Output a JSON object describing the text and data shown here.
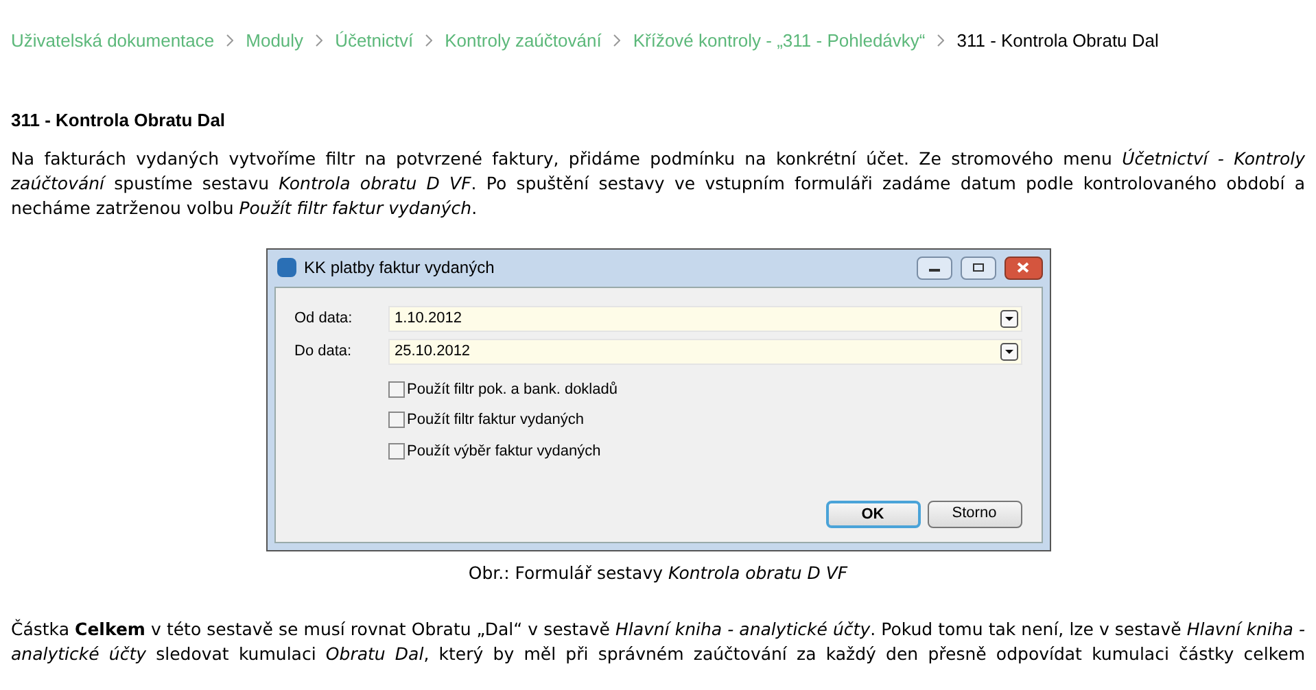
{
  "breadcrumb": [
    {
      "label": "Uživatelská dokumentace",
      "current": false
    },
    {
      "label": "Moduly",
      "current": false
    },
    {
      "label": "Účetnictví",
      "current": false
    },
    {
      "label": "Kontroly zaúčtování",
      "current": false
    },
    {
      "label": "Křížové kontroly - „311 - Pohledávky“",
      "current": false
    },
    {
      "label": "311 - Kontrola Obratu Dal",
      "current": true
    }
  ],
  "heading": "311 - Kontrola Obratu Dal",
  "intro": "Na fakturách vydaných vytvoříme filtr na potvrzené faktury, přidáme podmínku na konkrétní účet. Ze stromového menu *Účetnictví - Kontroly zaúčtování* spustíme sestavu *Kontrola obratu D VF*. Po spuštění sestavy ve vstupním formuláři zadáme datum podle kontrolovaného období a necháme zatrženou volbu *Použít filtr faktur vydaných*.",
  "dialog": {
    "title": "KK platby faktur vydaných",
    "fields": [
      {
        "label": "Od data:",
        "value": "1.10.2012"
      },
      {
        "label": "Do data:",
        "value": "25.10.2012"
      }
    ],
    "checkboxes": [
      {
        "label": "Použít filtr pok. a bank. dokladů",
        "checked": false
      },
      {
        "label": "Použít filtr faktur vydaných",
        "checked": false
      },
      {
        "label": "Použít výběr faktur vydaných",
        "checked": false
      }
    ],
    "buttons": [
      {
        "label": "OK",
        "default": true
      },
      {
        "label": "Storno",
        "default": false
      }
    ]
  },
  "caption": "Obr.: Formulář sestavy *Kontrola obratu D VF*",
  "paragraph": "Částka **Celkem** v této sestavě se musí rovnat Obratu „Dal“ v sestavě *Hlavní kniha - analytické účty*. Pokud tomu tak není, lze v sestavě *Hlavní kniha - analytické účty* sledovat kumulaci *Obratu Dal*, který by měl při správném zaúčtování za každý den přesně odpovídat kumulaci částky celkem"
}
